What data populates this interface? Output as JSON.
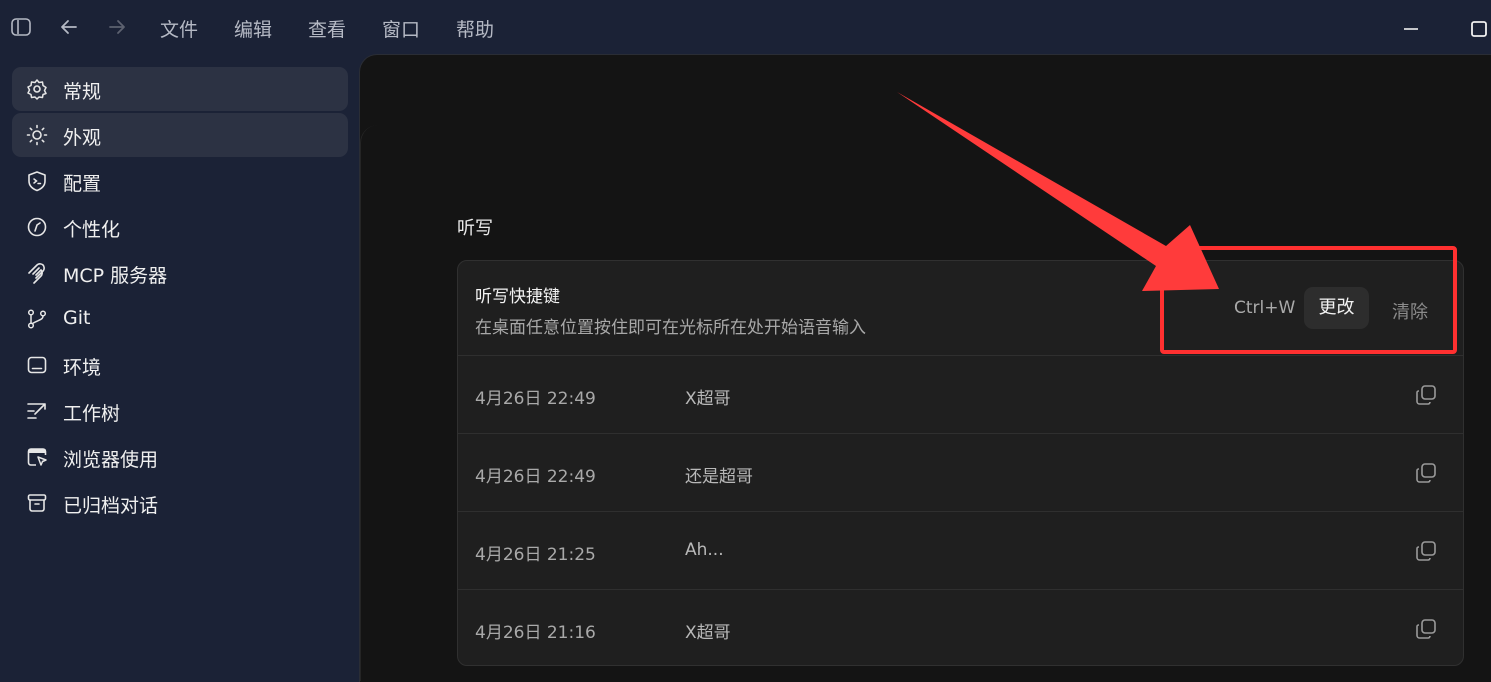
{
  "menu": {
    "items": [
      "文件",
      "编辑",
      "查看",
      "窗口",
      "帮助"
    ]
  },
  "sidebar": {
    "items": [
      {
        "label": "常规",
        "icon": "gear-icon"
      },
      {
        "label": "外观",
        "icon": "sun-icon"
      },
      {
        "label": "配置",
        "icon": "shield-code-icon"
      },
      {
        "label": "个性化",
        "icon": "personalize-icon"
      },
      {
        "label": "MCP 服务器",
        "icon": "mcp-icon"
      },
      {
        "label": "Git",
        "icon": "git-branch-icon"
      },
      {
        "label": "环境",
        "icon": "monitor-icon"
      },
      {
        "label": "工作树",
        "icon": "worktree-icon"
      },
      {
        "label": "浏览器使用",
        "icon": "browser-cursor-icon"
      },
      {
        "label": "已归档对话",
        "icon": "archive-icon"
      }
    ]
  },
  "main": {
    "section_title": "听写",
    "shortcut_card": {
      "title": "听写快捷键",
      "description": "在桌面任意位置按住即可在光标所在处开始语音输入",
      "shortcut": "Ctrl+W",
      "change_label": "更改",
      "clear_label": "清除"
    },
    "history": [
      {
        "time": "4月26日 22:49",
        "text": "X超哥"
      },
      {
        "time": "4月26日 22:49",
        "text": "还是超哥"
      },
      {
        "time": "4月26日 21:25",
        "text": "Ah..."
      },
      {
        "time": "4月26日 21:16",
        "text": "X超哥"
      }
    ]
  },
  "colors": {
    "annotation_red": "#ff3030",
    "background": "#141414",
    "sidebar": "#1b2236"
  }
}
